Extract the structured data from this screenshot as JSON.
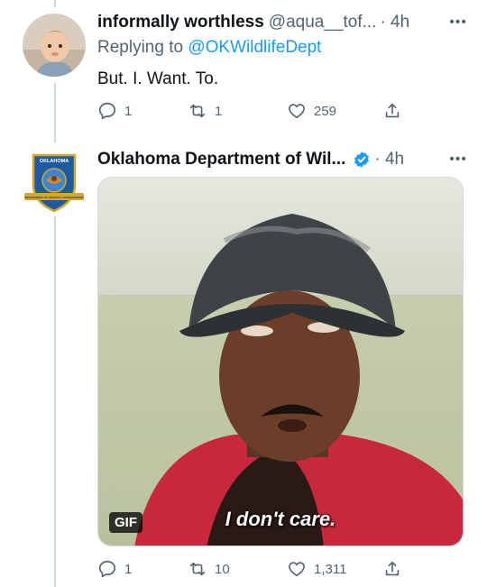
{
  "tweet1": {
    "name": "informally worthless",
    "handle": "@aqua__tof...",
    "time": "· 4h",
    "replying_prefix": "Replying to ",
    "replying_to": "@OKWildlifeDept",
    "text": "But. I. Want. To.",
    "reply_count": "1",
    "retweet_count": "1",
    "like_count": "259"
  },
  "tweet2": {
    "name": "Oklahoma Department of Wil...",
    "time": "· 4h",
    "avatar_top_text": "OKLAHOMA",
    "avatar_bottom_text": "DEPARTMENT OF WILDLIFE CONSERVATION",
    "media": {
      "badge": "GIF",
      "caption": "I don't care."
    },
    "reply_count": "1",
    "retweet_count": "10",
    "like_count": "1,311"
  },
  "icons": {
    "more": "ellipsis-icon",
    "reply": "reply-icon",
    "retweet": "retweet-icon",
    "like": "heart-icon",
    "share": "share-icon",
    "verified": "verified-badge-icon"
  },
  "colors": {
    "text": "#0f1419",
    "secondary": "#536471",
    "link": "#1d9bf0",
    "thread_line": "#cfd9de",
    "verified": "#1d9bf0"
  }
}
